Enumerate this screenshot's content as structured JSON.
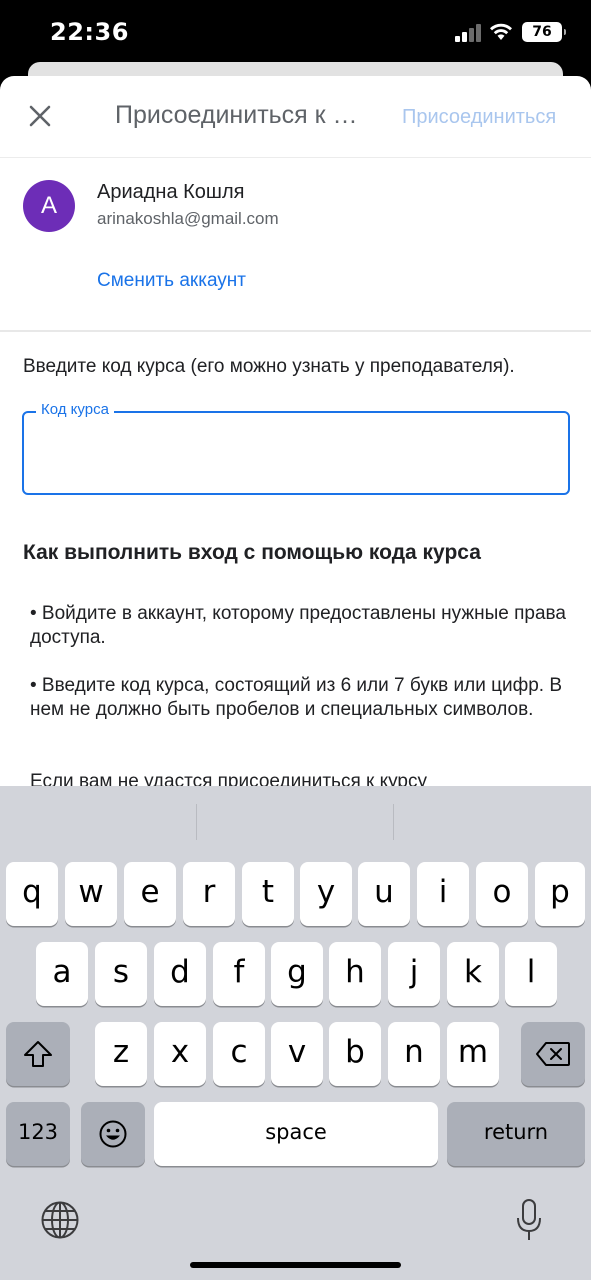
{
  "status": {
    "time": "22:36",
    "battery": "76"
  },
  "header": {
    "title": "Присоединиться к курсу",
    "join_label": "Присоединиться"
  },
  "account": {
    "avatar_letter": "А",
    "avatar_color": "#6d2db7",
    "name": "Ариадна Кошля",
    "email": "arinakoshla@gmail.com",
    "switch_label": "Сменить аккаунт"
  },
  "form": {
    "instruction": "Введите код курса (его можно узнать у преподавателя).",
    "code_label": "Код курса",
    "code_value": ""
  },
  "help": {
    "title": "Как выполнить вход с помощью кода курса",
    "paragraphs": [
      "• Войдите в аккаунт, которому предоставлены нужные права доступа.",
      "• Введите код курса, состоящий из 6 или 7 букв или цифр. В нем не должно быть пробелов и специальных символов.",
      "Если вам не удастся присоединиться к курсу"
    ]
  },
  "keyboard": {
    "row1": [
      "q",
      "w",
      "e",
      "r",
      "t",
      "y",
      "u",
      "i",
      "o",
      "p"
    ],
    "row2": [
      "a",
      "s",
      "d",
      "f",
      "g",
      "h",
      "j",
      "k",
      "l"
    ],
    "row3": [
      "z",
      "x",
      "c",
      "v",
      "b",
      "n",
      "m"
    ],
    "numbers_label": "123",
    "space_label": "space",
    "return_label": "return"
  },
  "colors": {
    "accent": "#1a73e8",
    "disabled_accent": "#a9c6ee"
  }
}
